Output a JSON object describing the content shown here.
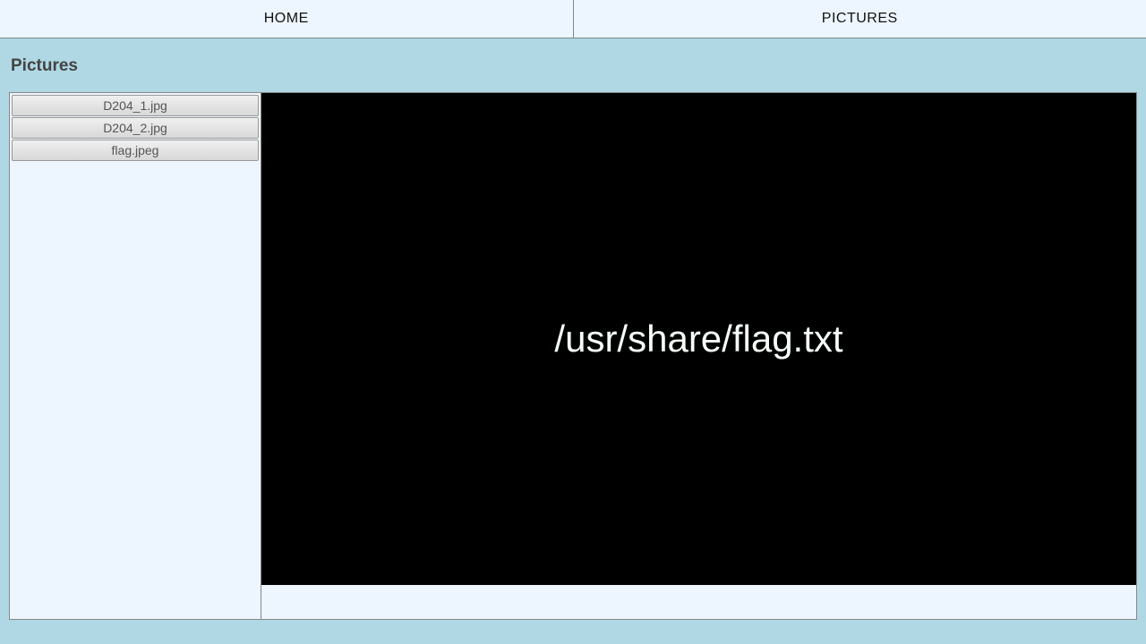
{
  "nav": {
    "home": "HOME",
    "pictures": "PICTURES"
  },
  "page": {
    "title": "Pictures"
  },
  "files": [
    "D204_1.jpg",
    "D204_2.jpg",
    "flag.jpeg"
  ],
  "preview": {
    "text": "/usr/share/flag.txt"
  }
}
